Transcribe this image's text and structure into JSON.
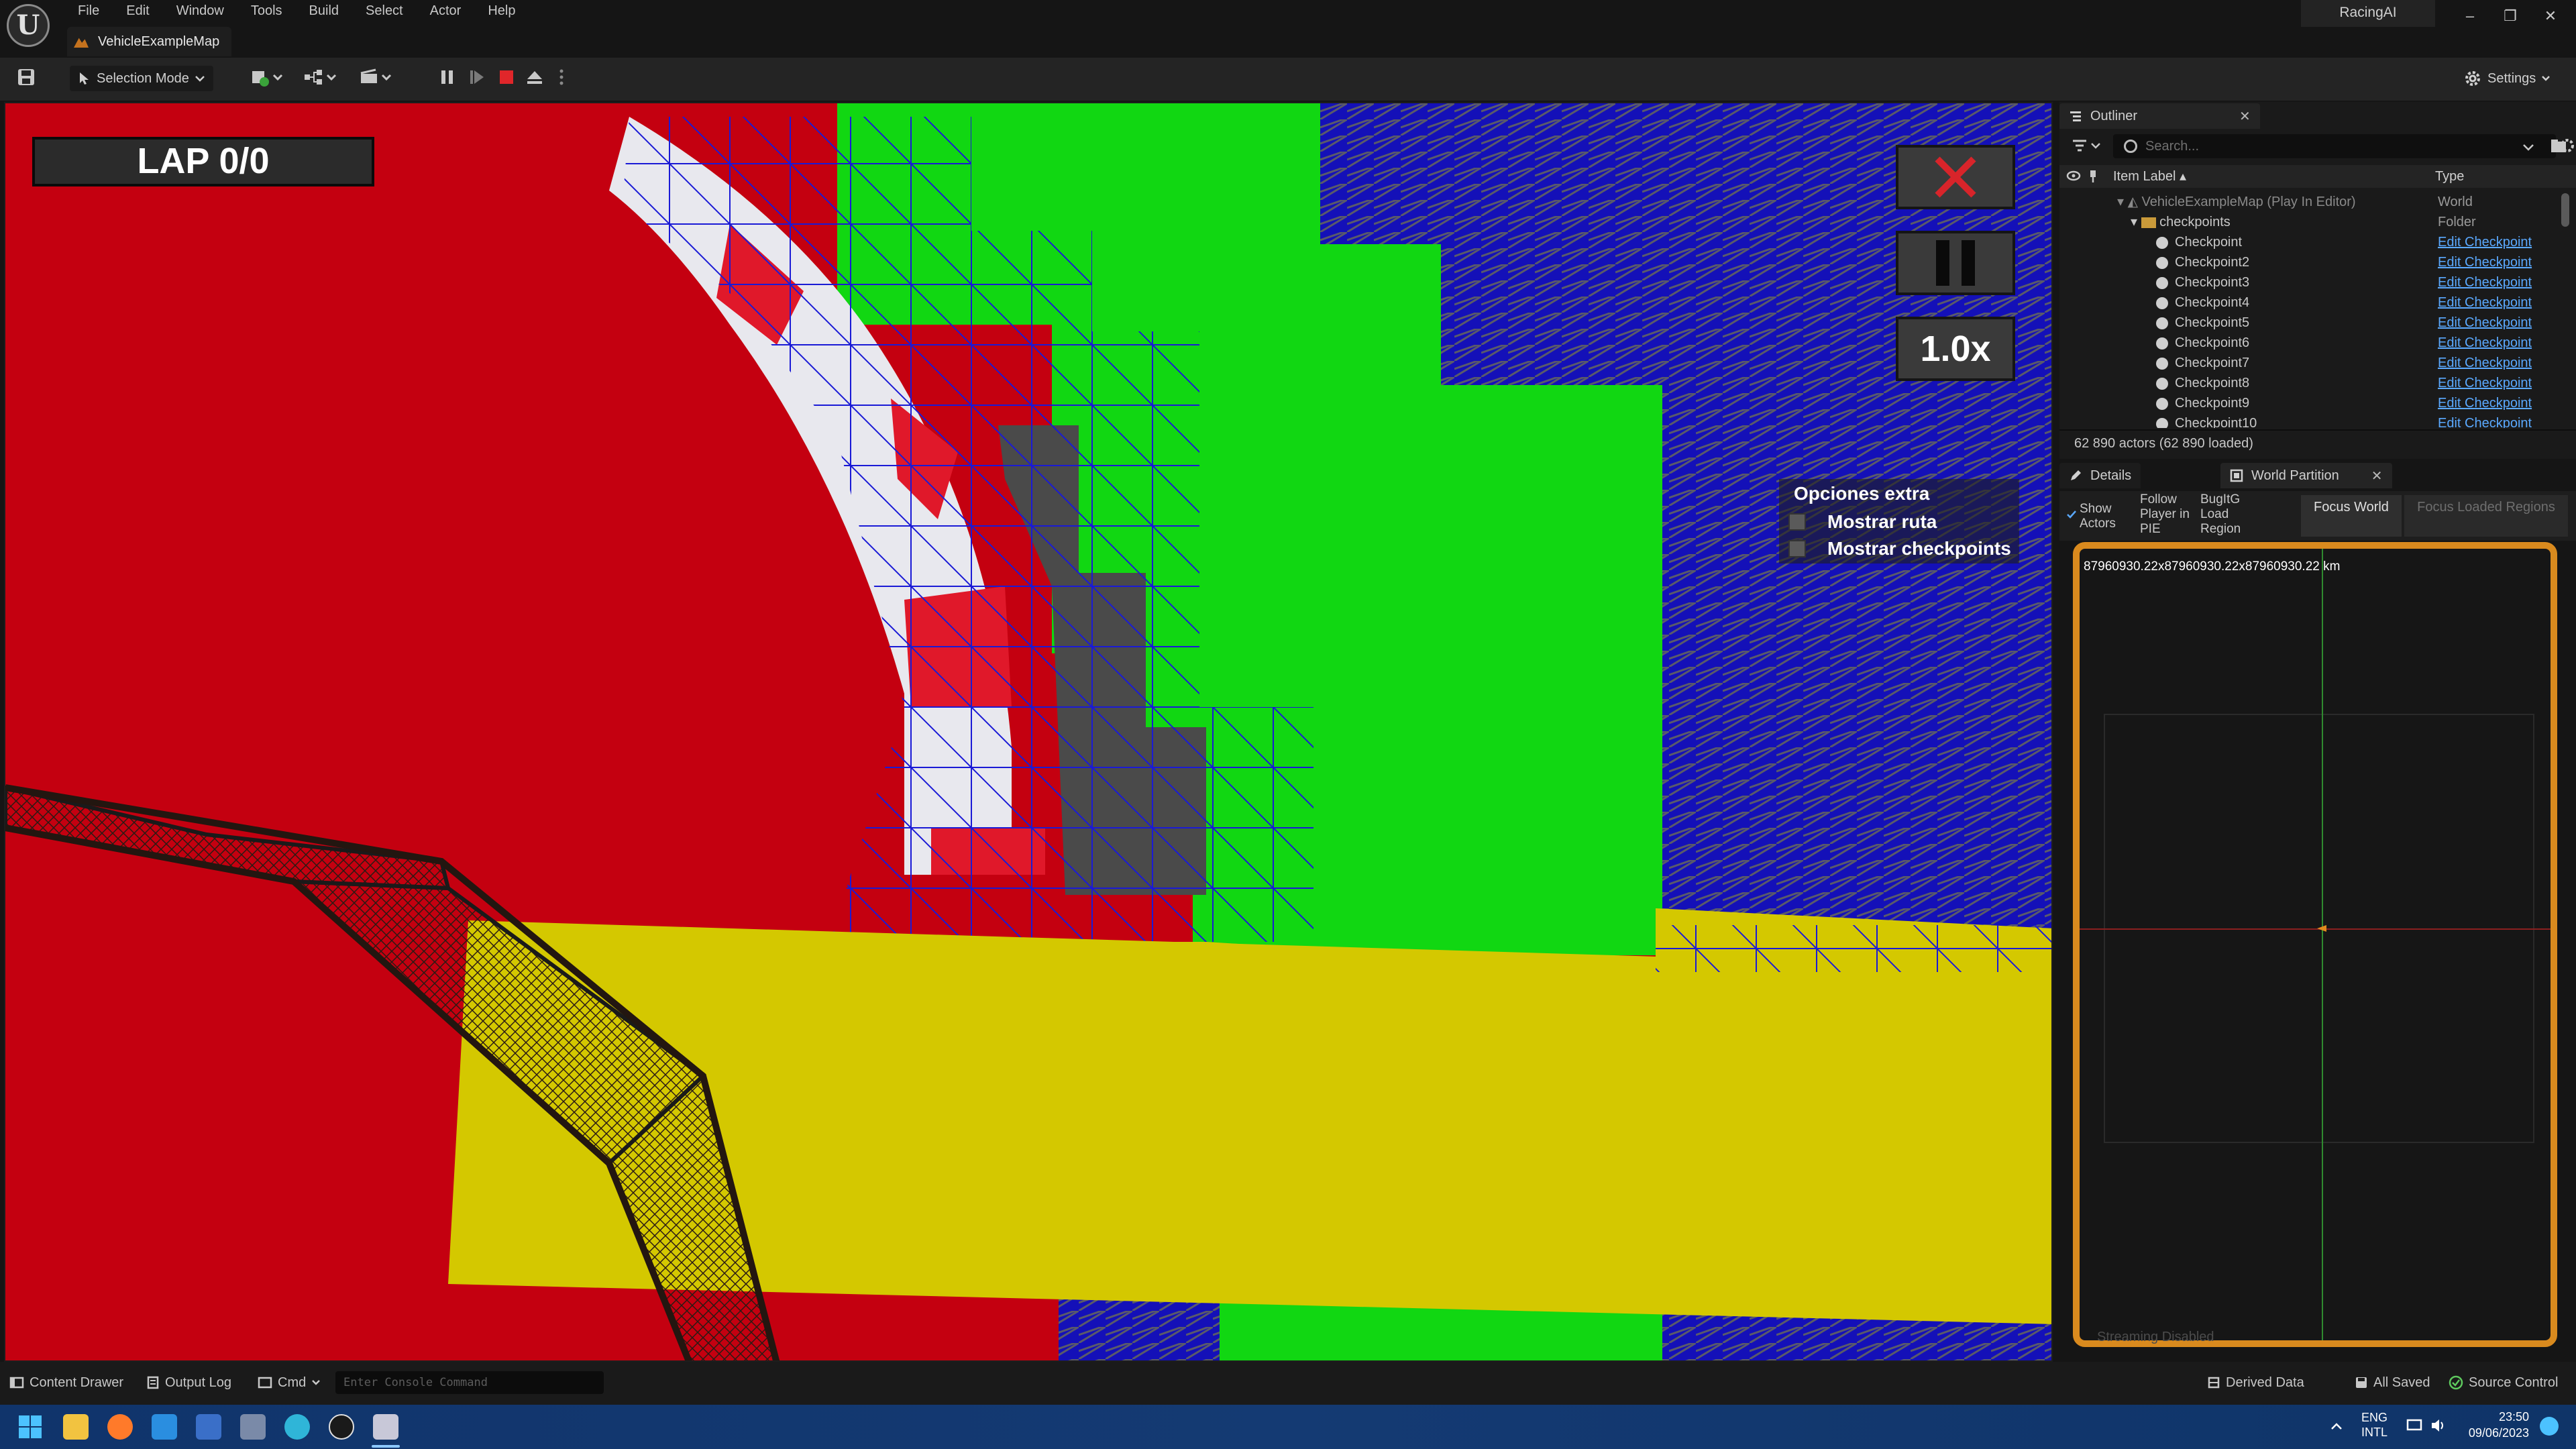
{
  "app": {
    "logo_letter": "U",
    "menu": [
      "File",
      "Edit",
      "Window",
      "Tools",
      "Build",
      "Select",
      "Actor",
      "Help"
    ],
    "map_tab": "VehicleExampleMap",
    "project_name": "RacingAI",
    "window_controls": [
      "–",
      "❐",
      "✕"
    ]
  },
  "toolbar": {
    "selection_mode": "Selection Mode",
    "settings": "Settings"
  },
  "hud": {
    "lap": "LAP 0/0",
    "speed": "1.0x",
    "extra_title": "Opciones extra",
    "options": [
      {
        "label": "Mostrar ruta",
        "checked": false
      },
      {
        "label": "Mostrar checkpoints",
        "checked": false
      }
    ]
  },
  "outliner": {
    "tab": "Outliner",
    "search_placeholder": "Search...",
    "col_label": "Item Label ▴",
    "col_type": "Type",
    "world_row": {
      "label": "VehicleExampleMap (Play In Editor)",
      "type": "World"
    },
    "folder_row": {
      "label": "checkpoints",
      "type": "Folder"
    },
    "items": [
      {
        "label": "Checkpoint",
        "type": "Edit Checkpoint"
      },
      {
        "label": "Checkpoint2",
        "type": "Edit Checkpoint"
      },
      {
        "label": "Checkpoint3",
        "type": "Edit Checkpoint"
      },
      {
        "label": "Checkpoint4",
        "type": "Edit Checkpoint"
      },
      {
        "label": "Checkpoint5",
        "type": "Edit Checkpoint"
      },
      {
        "label": "Checkpoint6",
        "type": "Edit Checkpoint"
      },
      {
        "label": "Checkpoint7",
        "type": "Edit Checkpoint"
      },
      {
        "label": "Checkpoint8",
        "type": "Edit Checkpoint"
      },
      {
        "label": "Checkpoint9",
        "type": "Edit Checkpoint"
      },
      {
        "label": "Checkpoint10",
        "type": "Edit Checkpoint"
      }
    ],
    "status": "62 890 actors (62 890 loaded)"
  },
  "details": {
    "tab_details": "Details",
    "tab_world_partition": "World Partition",
    "opt_show_actors": "Show Actors",
    "opt_follow_player": "Follow Player in PIE",
    "opt_bugit": "BugItG Load Region",
    "focus_world": "Focus World",
    "focus_loaded": "Focus Loaded Regions",
    "world_size": "87960930.22x87960930.22x87960930.22 km",
    "streaming": "Streaming Disabled"
  },
  "statusbar": {
    "content_drawer": "Content Drawer",
    "output_log": "Output Log",
    "cmd": "Cmd",
    "console_placeholder": "Enter Console Command",
    "derived_data": "Derived Data",
    "all_saved": "All Saved",
    "source_control": "Source Control"
  },
  "taskbar": {
    "lang_1": "ENG",
    "lang_2": "INTL",
    "time": "23:50",
    "date": "09/06/2023"
  },
  "colors": {
    "road_red": "#c40010",
    "green_block": "#11d712",
    "yellow_block": "#d4c800",
    "wire_blue": "#1414d2",
    "link_blue": "#5aa9ff",
    "wp_border": "#d98a1e",
    "close_red": "#d8242a"
  }
}
